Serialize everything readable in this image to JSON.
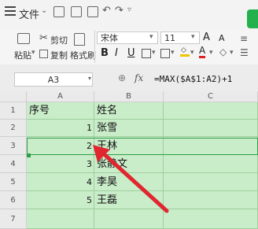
{
  "quick_access": {
    "file_label": "文件"
  },
  "ribbon": {
    "cut_label": "剪切",
    "paste_label": "粘贴",
    "copy_label": "复制",
    "format_painter_label": "格式刷",
    "font_name": "宋体",
    "font_size": "11",
    "bold": "B",
    "italic": "I",
    "underline": "U",
    "font_grow": "A",
    "font_shrink": "A"
  },
  "formula_bar": {
    "name_box": "A3",
    "fx_label": "fx",
    "formula": "=MAX($A$1:A2)+1"
  },
  "columns": [
    "A",
    "B",
    "C"
  ],
  "rows": [
    {
      "num": "1",
      "a": "序号",
      "b": "姓名"
    },
    {
      "num": "2",
      "a": "1",
      "b": "张雪"
    },
    {
      "num": "3",
      "a": "2",
      "b": "王林"
    },
    {
      "num": "4",
      "a": "3",
      "b": "张静文"
    },
    {
      "num": "5",
      "a": "4",
      "b": "李昊"
    },
    {
      "num": "6",
      "a": "5",
      "b": "王磊"
    },
    {
      "num": "7",
      "a": "",
      "b": ""
    }
  ],
  "colors": {
    "accent": "#22b14c",
    "cell_bg": "#c9ecc9",
    "arrow": "#e0262e"
  }
}
